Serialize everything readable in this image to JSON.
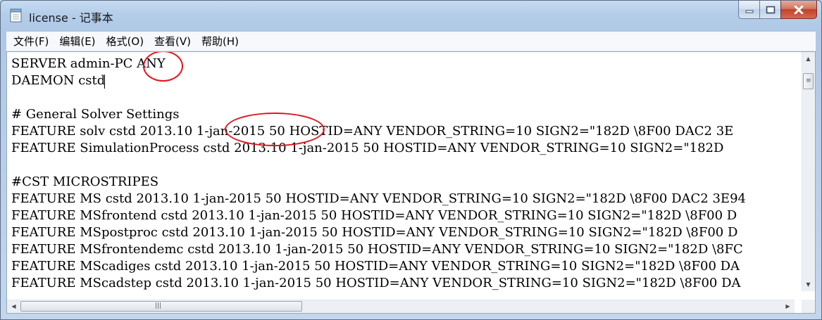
{
  "window": {
    "title": "license - 记事本",
    "icon": "notepad-icon",
    "buttons": {
      "minimize": "minimize-icon",
      "maximize": "maximize-icon",
      "close": "close-icon"
    }
  },
  "menu": [
    "文件(F)",
    "编辑(E)",
    "格式(O)",
    "查看(V)",
    "帮助(H)"
  ],
  "lines": [
    "SERVER admin-PC ANY",
    "DAEMON cstd",
    "",
    "# General Solver Settings",
    "FEATURE solv cstd 2013.10 1-jan-2015 50 HOSTID=ANY VENDOR_STRING=10 SIGN2=\"182D \\8F00 DAC2 3E",
    "FEATURE SimulationProcess cstd 2013.10 1-jan-2015 50 HOSTID=ANY VENDOR_STRING=10 SIGN2=\"182D",
    "",
    "#CST MICROSTRIPES",
    "FEATURE MS cstd 2013.10 1-jan-2015 50 HOSTID=ANY VENDOR_STRING=10 SIGN2=\"182D \\8F00 DAC2 3E94",
    "FEATURE MSfrontend cstd 2013.10 1-jan-2015 50 HOSTID=ANY VENDOR_STRING=10 SIGN2=\"182D \\8F00 D",
    "FEATURE MSpostproc cstd 2013.10 1-jan-2015 50 HOSTID=ANY VENDOR_STRING=10 SIGN2=\"182D \\8F00 D",
    "FEATURE MSfrontendemc cstd 2013.10 1-jan-2015 50 HOSTID=ANY VENDOR_STRING=10 SIGN2=\"182D \\8FC",
    "FEATURE MScadiges cstd 2013.10 1-jan-2015 50 HOSTID=ANY VENDOR_STRING=10 SIGN2=\"182D \\8F00 DA",
    "FEATURE MScadstep cstd 2013.10 1-jan-2015 50 HOSTID=ANY VENDOR_STRING=10 SIGN2=\"182D \\8F00 DA"
  ],
  "annotations": {
    "color": "#e0141e"
  },
  "colors": {
    "frame": "#b3cdea",
    "close_button": "#c0422a"
  }
}
